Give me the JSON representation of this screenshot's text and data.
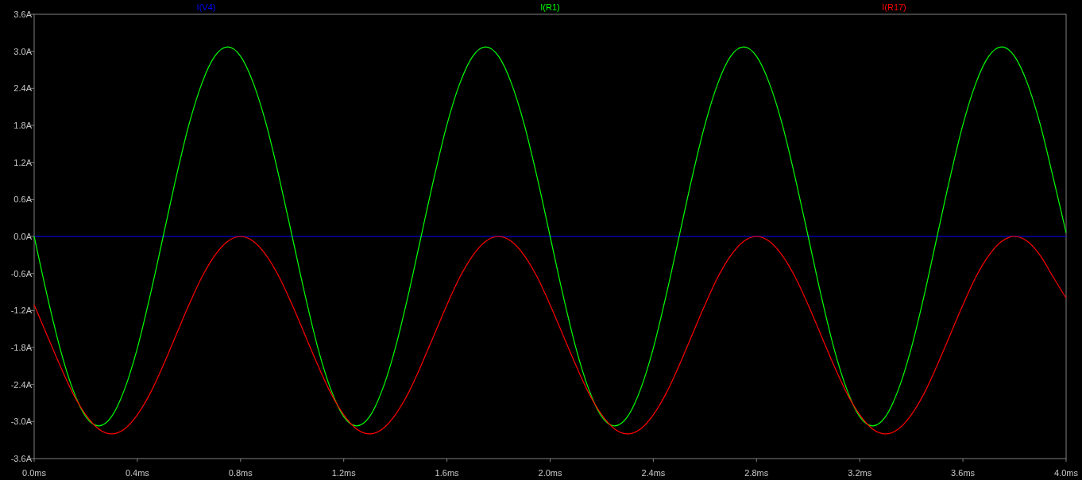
{
  "plot": {
    "chart_data": {
      "type": "line",
      "xlim": [
        0,
        4
      ],
      "ylim": [
        -3.6,
        3.6
      ],
      "x": [
        0,
        0.05,
        0.1,
        0.15,
        0.2,
        0.25,
        0.3,
        0.35,
        0.4,
        0.45,
        0.5,
        0.55,
        0.6,
        0.65,
        0.7,
        0.75,
        0.8,
        0.85,
        0.9,
        0.95,
        1,
        1.05,
        1.1,
        1.15,
        1.2,
        1.25,
        1.3,
        1.35,
        1.4,
        1.45,
        1.5,
        1.55,
        1.6,
        1.65,
        1.7,
        1.75,
        1.8,
        1.85,
        1.9,
        1.95,
        2,
        2.05,
        2.1,
        2.15,
        2.2,
        2.25,
        2.3,
        2.35,
        2.4,
        2.45,
        2.5,
        2.55,
        2.6,
        2.65,
        2.7,
        2.75,
        2.8,
        2.85,
        2.9,
        2.95,
        3,
        3.05,
        3.1,
        3.15,
        3.2,
        3.25,
        3.3,
        3.35,
        3.4,
        3.45,
        3.5,
        3.55,
        3.6,
        3.65,
        3.7,
        3.75,
        3.8,
        3.85,
        3.9,
        3.95,
        4
      ],
      "xticks": [
        {
          "value": 0,
          "label": "0.0ms"
        },
        {
          "value": 0.4,
          "label": "0.4ms"
        },
        {
          "value": 0.8,
          "label": "0.8ms"
        },
        {
          "value": 1.2,
          "label": "1.2ms"
        },
        {
          "value": 1.6,
          "label": "1.6ms"
        },
        {
          "value": 2.0,
          "label": "2.0ms"
        },
        {
          "value": 2.4,
          "label": "2.4ms"
        },
        {
          "value": 2.8,
          "label": "2.8ms"
        },
        {
          "value": 3.2,
          "label": "3.2ms"
        },
        {
          "value": 3.6,
          "label": "3.6ms"
        },
        {
          "value": 4.0,
          "label": "4.0ms"
        }
      ],
      "yticks": [
        {
          "value": 3.6,
          "label": "3.6A"
        },
        {
          "value": 3.0,
          "label": "3.0A"
        },
        {
          "value": 2.4,
          "label": "2.4A"
        },
        {
          "value": 1.8,
          "label": "1.8A"
        },
        {
          "value": 1.2,
          "label": "1.2A"
        },
        {
          "value": 0.6,
          "label": "0.6A"
        },
        {
          "value": 0,
          "label": "0.0A"
        },
        {
          "value": -0.6,
          "label": "-0.6A"
        },
        {
          "value": -1.2,
          "label": "-1.2A"
        },
        {
          "value": -1.8,
          "label": "-1.8A"
        },
        {
          "value": -2.4,
          "label": "-2.4A"
        },
        {
          "value": -3.0,
          "label": "-3.0A"
        },
        {
          "value": -3.6,
          "label": "-3.6A"
        }
      ],
      "series": [
        {
          "name": "I(V4)",
          "color": "#0000ff",
          "values": [
            0,
            0,
            0,
            0,
            0,
            0,
            0,
            0,
            0,
            0,
            0,
            0,
            0,
            0,
            0,
            0,
            0,
            0,
            0,
            0,
            0,
            0,
            0,
            0,
            0,
            0,
            0,
            0,
            0,
            0,
            0,
            0,
            0,
            0,
            0,
            0,
            0,
            0,
            0,
            0,
            0,
            0,
            0,
            0,
            0,
            0,
            0,
            0,
            0,
            0,
            0,
            0,
            0,
            0,
            0,
            0,
            0,
            0,
            0,
            0,
            0,
            0,
            0,
            0,
            0,
            0,
            0,
            0,
            0,
            0,
            0,
            0,
            0,
            0,
            0,
            0,
            0,
            0,
            0,
            0,
            0
          ]
        },
        {
          "name": "I(R1)",
          "color": "#00ff00",
          "values": [
            0,
            -0.95,
            -1.81,
            -2.48,
            -2.92,
            -3.07,
            -2.92,
            -2.48,
            -1.81,
            -0.95,
            0,
            0.95,
            1.81,
            2.48,
            2.92,
            3.07,
            2.92,
            2.48,
            1.81,
            0.95,
            0,
            -0.95,
            -1.81,
            -2.48,
            -2.92,
            -3.07,
            -2.92,
            -2.48,
            -1.81,
            -0.95,
            0,
            0.95,
            1.81,
            2.48,
            2.92,
            3.07,
            2.92,
            2.48,
            1.81,
            0.95,
            0,
            -0.95,
            -1.81,
            -2.48,
            -2.92,
            -3.07,
            -2.92,
            -2.48,
            -1.81,
            -0.95,
            0,
            0.95,
            1.81,
            2.48,
            2.92,
            3.07,
            2.92,
            2.48,
            1.81,
            0.95,
            0,
            -0.95,
            -1.81,
            -2.48,
            -2.92,
            -3.07,
            -2.92,
            -2.48,
            -1.81,
            -0.95,
            0,
            0.95,
            1.81,
            2.48,
            2.92,
            3.07,
            2.92,
            2.48,
            1.81,
            0.95,
            0.06
          ]
        },
        {
          "name": "I(R17)",
          "color": "#ff0000",
          "values": [
            -1.11,
            -1.6,
            -2.09,
            -2.54,
            -2.89,
            -3.12,
            -3.2,
            -3.12,
            -2.89,
            -2.54,
            -2.09,
            -1.6,
            -1.11,
            -0.66,
            -0.31,
            -0.08,
            0,
            -0.08,
            -0.31,
            -0.66,
            -1.11,
            -1.6,
            -2.09,
            -2.54,
            -2.89,
            -3.12,
            -3.2,
            -3.12,
            -2.89,
            -2.54,
            -2.09,
            -1.6,
            -1.11,
            -0.66,
            -0.31,
            -0.08,
            0,
            -0.08,
            -0.31,
            -0.66,
            -1.11,
            -1.6,
            -2.09,
            -2.54,
            -2.89,
            -3.12,
            -3.2,
            -3.12,
            -2.89,
            -2.54,
            -2.09,
            -1.6,
            -1.11,
            -0.66,
            -0.31,
            -0.08,
            0,
            -0.08,
            -0.31,
            -0.66,
            -1.11,
            -1.6,
            -2.09,
            -2.54,
            -2.89,
            -3.12,
            -3.2,
            -3.12,
            -2.89,
            -2.54,
            -2.09,
            -1.6,
            -1.11,
            -0.66,
            -0.31,
            -0.08,
            0,
            -0.08,
            -0.31,
            -0.66,
            -1.0
          ]
        }
      ]
    }
  }
}
